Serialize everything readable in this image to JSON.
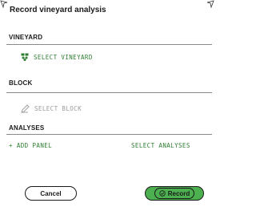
{
  "header": {
    "title": "Record vineyard analysis"
  },
  "sections": {
    "vineyard": {
      "label": "VINEYARD",
      "action_label": "SELECT VINEYARD",
      "action_icon": "grape-icon"
    },
    "block": {
      "label": "BLOCK",
      "action_label": "SELECT BLOCK",
      "action_icon": "pencil-icon"
    },
    "analyses": {
      "label": "ANALYSES",
      "add_label": "+ ADD PANEL",
      "select_label": "SELECT ANALYSES"
    }
  },
  "footer": {
    "cancel_label": "Cancel",
    "record_label": "Record",
    "record_icon": "check-circle-icon"
  },
  "colors": {
    "accent_green": "#4caf50",
    "link_green": "#2e7d32",
    "disabled_gray": "#9a9a9a"
  }
}
